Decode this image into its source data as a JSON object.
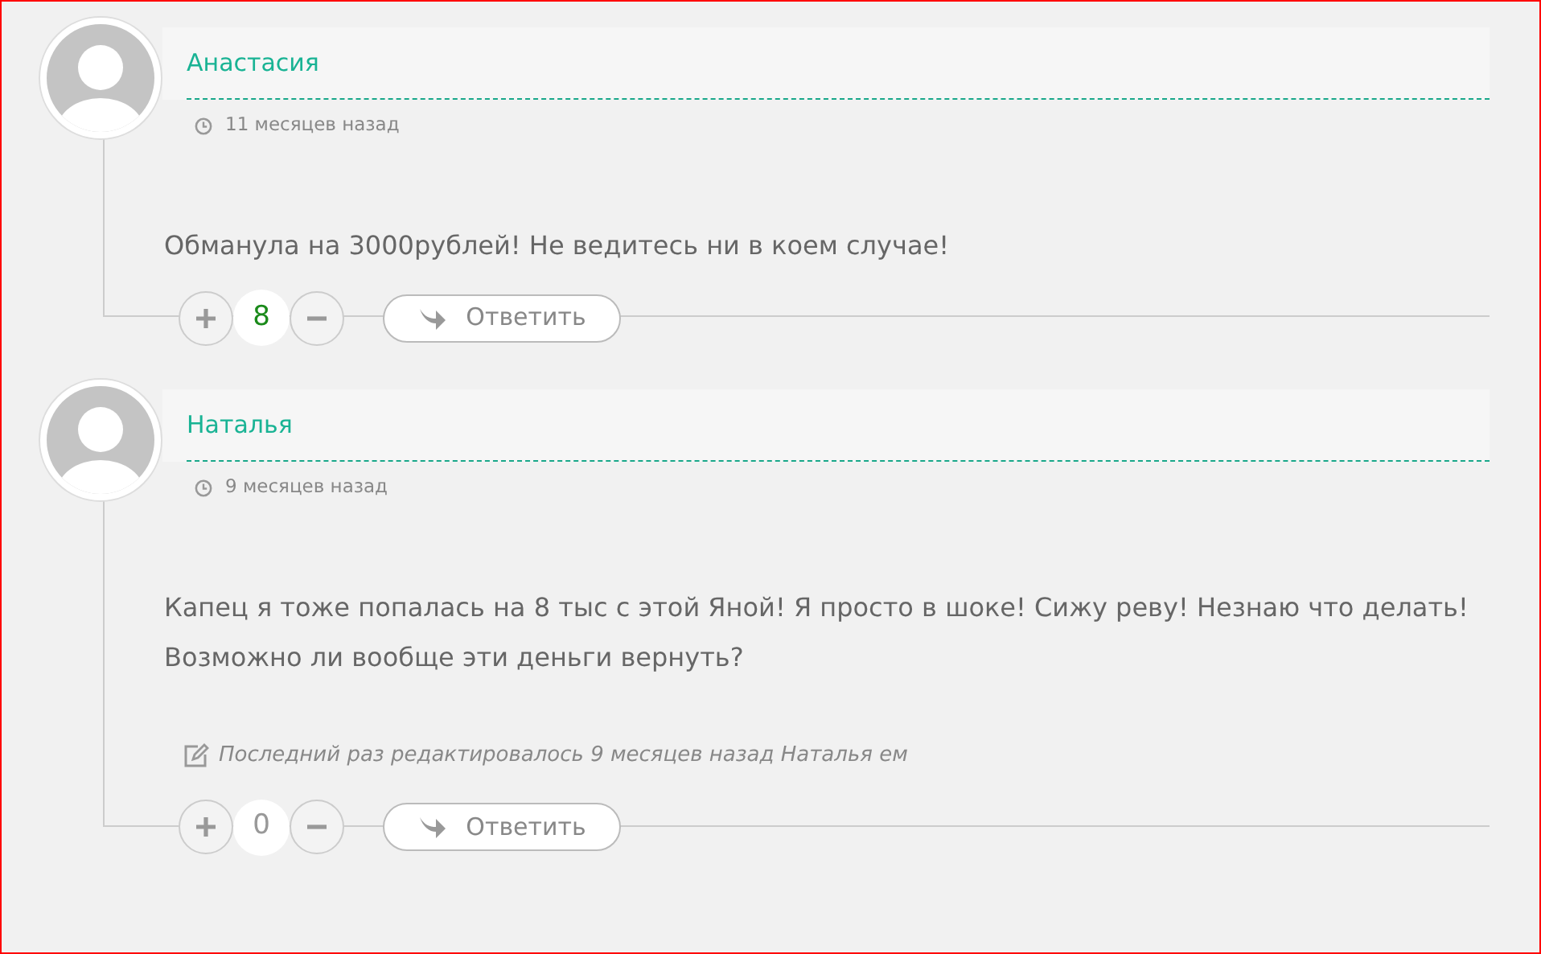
{
  "comments": [
    {
      "author": "Анастасия",
      "time": "11 месяцев назад",
      "body": [
        "Обманула на 3000рублей! Не ведитесь ни в коем случае!"
      ],
      "score": "8",
      "positive": true,
      "reply": "Ответить"
    },
    {
      "author": "Наталья",
      "time": "9 месяцев назад",
      "body": [
        "Капец я тоже попалась на 8 тыс с этой Яной! Я просто в шоке! Сижу реву! Незнаю что делать!",
        "Возможно ли вообще эти деньги вернуть?"
      ],
      "edited": "Последний раз редактировалось 9 месяцев назад Наталья ем",
      "score": "0",
      "positive": false,
      "reply": "Ответить"
    }
  ]
}
